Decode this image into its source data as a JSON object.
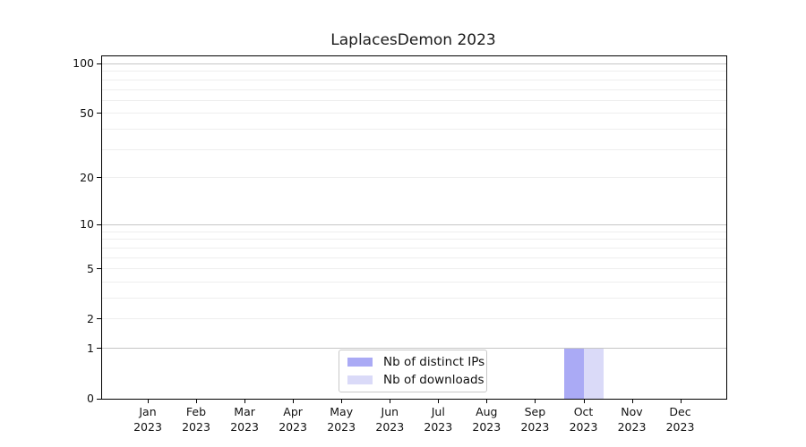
{
  "chart_data": {
    "type": "bar",
    "title": "LaplacesDemon 2023",
    "categories": [
      "Jan",
      "Feb",
      "Mar",
      "Apr",
      "May",
      "Jun",
      "Jul",
      "Aug",
      "Sep",
      "Oct",
      "Nov",
      "Dec"
    ],
    "x_year_label": "2023",
    "series": [
      {
        "name": "Nb of distinct IPs",
        "color": "#aaaaf5",
        "values": [
          0,
          0,
          0,
          0,
          0,
          0,
          0,
          0,
          0,
          1,
          0,
          0
        ]
      },
      {
        "name": "Nb of downloads",
        "color": "#dadaf8",
        "values": [
          0,
          0,
          0,
          0,
          0,
          0,
          0,
          0,
          0,
          1,
          0,
          0
        ]
      }
    ],
    "y_axis": {
      "scale": "log1p",
      "ylim": [
        0,
        111
      ],
      "tick_values": [
        0,
        1,
        2,
        5,
        10,
        20,
        50,
        100
      ],
      "major_grid_values": [
        1,
        10,
        100
      ],
      "minor_grid_values": [
        2,
        3,
        4,
        5,
        6,
        7,
        8,
        9,
        20,
        30,
        40,
        50,
        60,
        70,
        80,
        90
      ]
    },
    "xlabel": "",
    "ylabel": "",
    "grid": "horizontal",
    "legend_position": "inside-bottom-center"
  },
  "colors": {
    "distinct_ips": "#aaaaf5",
    "downloads": "#dadaf8",
    "major_grid": "#c6c6c6",
    "minor_grid": "#eeeeee",
    "axis": "#000000",
    "legend_border": "#c8c8c8",
    "background": "#ffffff"
  }
}
